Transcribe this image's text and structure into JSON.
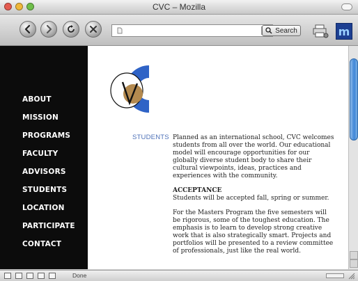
{
  "window": {
    "title": "CVC – Mozilla"
  },
  "toolbar": {
    "search_label": "Search",
    "url_value": ""
  },
  "nav": {
    "items": [
      "ABOUT",
      "MISSION",
      "PROGRAMS",
      "FACULTY",
      "ADVISORS",
      "STUDENTS",
      "LOCATION",
      "PARTICIPATE",
      "CONTACT"
    ]
  },
  "main": {
    "section_label": "STUDENTS",
    "paragraph1": "Planned as an international school, CVC welcomes students from all over the world. Our educational model will encourage opportunities for our globally diverse student body to share their cultural viewpoints, ideas, practices and experiences with the community.",
    "acceptance_heading": "Acceptance",
    "acceptance_text": "Students will be accepted fall, spring or summer.",
    "paragraph3": "For the Masters Program the five semesters will be rigorous, some of the toughest education. The emphasis is to learn to develop strong creative work that is also strategically smart. Projects and portfolios will be presented to a review committee of professionals, just like the real world."
  },
  "status": {
    "text": "Done"
  },
  "colors": {
    "nav_bg": "#0c0c0c",
    "accent_blue": "#2f63c6",
    "logo_gold": "#b48a4f",
    "label_blue": "#4e71b8"
  },
  "icons": {
    "back": "back-arrow-icon",
    "forward": "forward-arrow-icon",
    "reload": "reload-icon",
    "stop": "stop-icon",
    "print": "print-icon",
    "logo": "mozilla-logo-icon"
  }
}
